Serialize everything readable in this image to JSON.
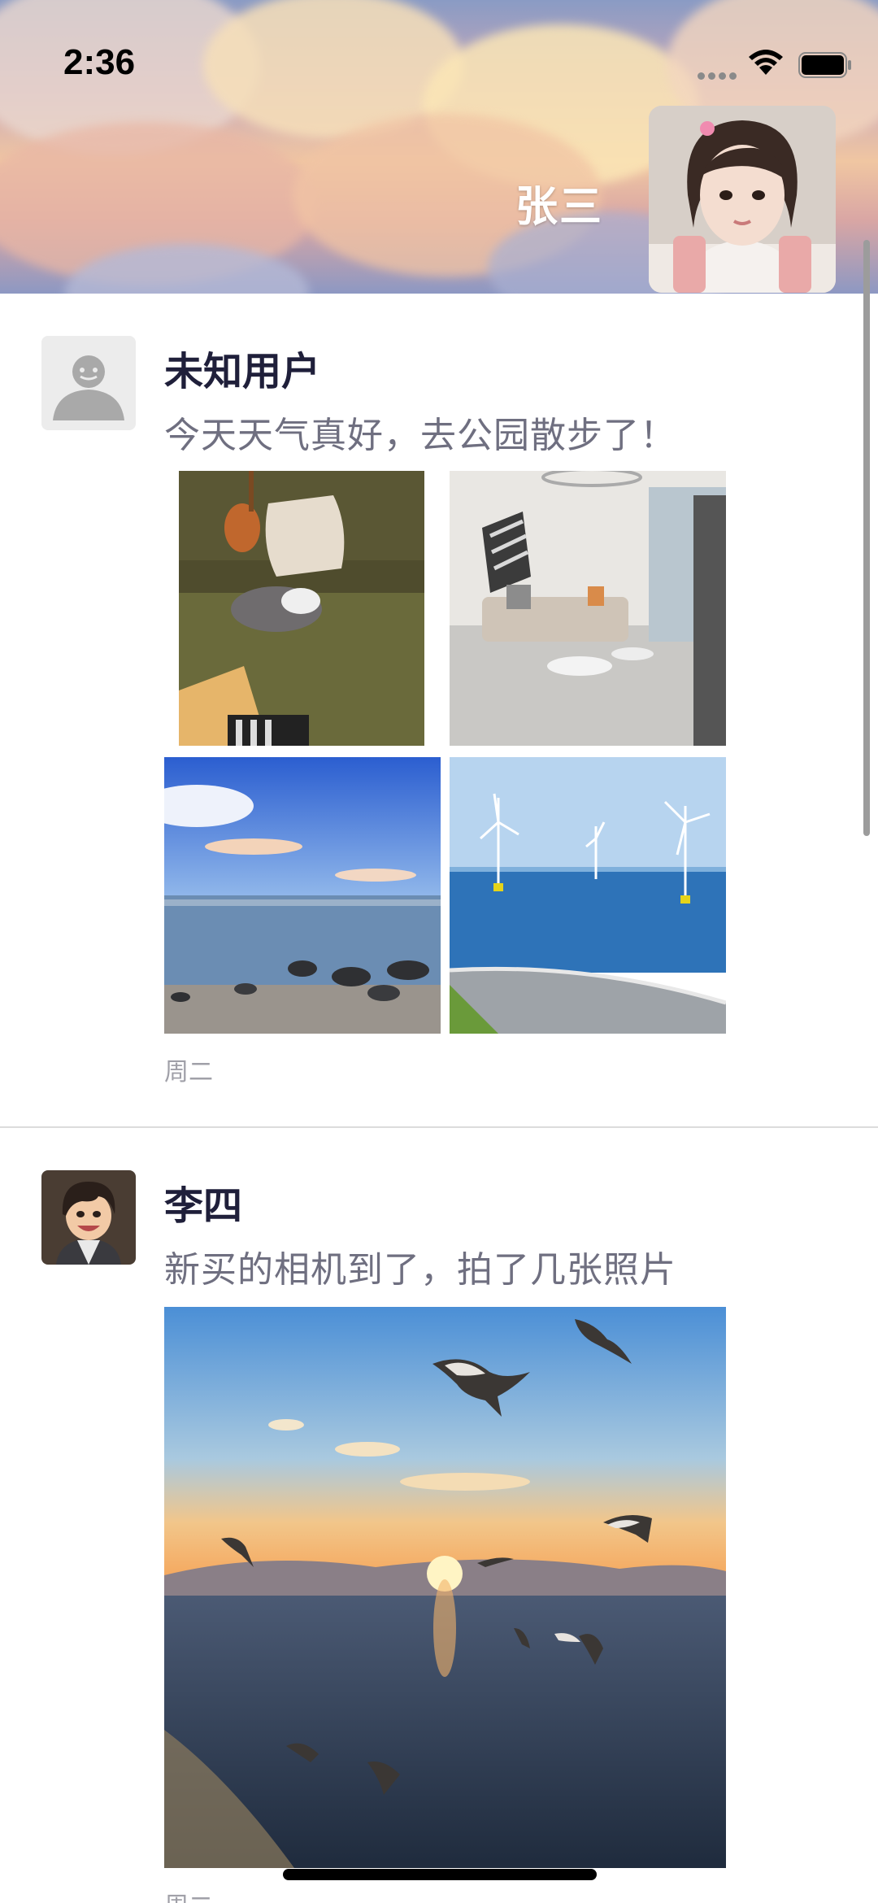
{
  "status_bar": {
    "time": "2:36",
    "icons": [
      "cellular-dots-icon",
      "wifi-icon",
      "battery-icon"
    ]
  },
  "profile": {
    "user_name": "张三",
    "cover_image": "sunset-clouds",
    "avatar_image": "girl-portrait"
  },
  "posts": [
    {
      "author": "未知用户",
      "avatar": "default-person-icon",
      "text": "今天天气真好，去公园散步了！",
      "time": "周二",
      "photos": [
        "sofa-with-ukulele-and-cat",
        "living-room-interior",
        "seaside-rocks-sunset",
        "offshore-wind-turbines"
      ]
    },
    {
      "author": "李四",
      "avatar": "cartoon-boy-avatar",
      "text": "新买的相机到了，拍了几张照片",
      "time": "周二",
      "photos": [
        "seagulls-over-sea-at-sunset"
      ]
    }
  ],
  "colors": {
    "author_name": "#1f1f3a",
    "post_text": "#6f6f80",
    "timestamp": "#a0a0a8",
    "divider": "#dcdcdc"
  }
}
